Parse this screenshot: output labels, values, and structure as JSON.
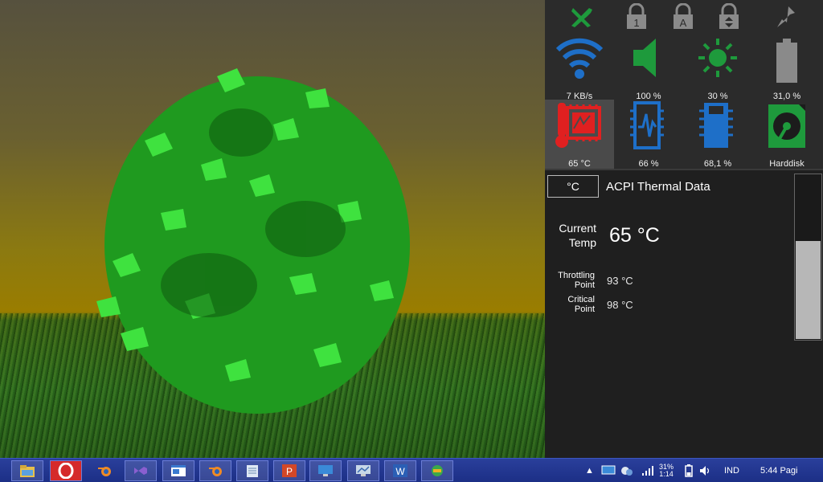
{
  "panel": {
    "top_icons": [
      "wrench-icon",
      "lock-1-icon",
      "lock-a-icon",
      "lock-scroll-icon",
      "pin-icon"
    ],
    "lock_labels": {
      "lock1": "1",
      "locka": "A"
    },
    "tiles": [
      {
        "name": "network",
        "icon": "wifi-icon",
        "label": "7 KB/s",
        "color": "#1e6fc8"
      },
      {
        "name": "volume",
        "icon": "speaker-icon",
        "label": "100 %",
        "color": "#1e9a3c"
      },
      {
        "name": "brightness",
        "icon": "sun-icon",
        "label": "30 %",
        "color": "#1e9a3c"
      },
      {
        "name": "battery",
        "icon": "battery-icon",
        "label": "31,0 %",
        "color": "#8a8a8a"
      },
      {
        "name": "temperature",
        "icon": "thermometer-chip-icon",
        "label": "65 °C",
        "color": "#e02020"
      },
      {
        "name": "cpu",
        "icon": "cpu-chip-icon",
        "label": "66 %",
        "color": "#1e6fc8"
      },
      {
        "name": "memory",
        "icon": "memory-chip-icon",
        "label": "68,1 %",
        "color": "#1e6fc8"
      },
      {
        "name": "harddisk",
        "icon": "disk-icon",
        "label": "Harddisk",
        "color": "#1e9a3c"
      }
    ],
    "detail": {
      "unit_button": "°C",
      "title": "ACPI Thermal Data",
      "current_label_1": "Current",
      "current_label_2": "Temp",
      "current_value": "65 °C",
      "throttling_label_1": "Throttling",
      "throttling_label_2": "Point",
      "throttling_value": "93 °C",
      "critical_label_1": "Critical",
      "critical_label_2": "Point",
      "critical_value": "98 °C",
      "gauge_level": 0.6
    }
  },
  "taskbar": {
    "apps": [
      "file-explorer-icon",
      "opera-icon",
      "blender-icon",
      "visual-studio-icon",
      "window-app-icon",
      "blender-icon",
      "notepad-icon",
      "powerpoint-icon",
      "remote-desktop-icon",
      "monitor-icon",
      "word-icon",
      "network-app-icon"
    ],
    "tray": {
      "arrow": "▲",
      "signal_top": "31%",
      "signal_bottom": "1:14",
      "language": "IND",
      "clock": "5:44 Pagi"
    }
  }
}
